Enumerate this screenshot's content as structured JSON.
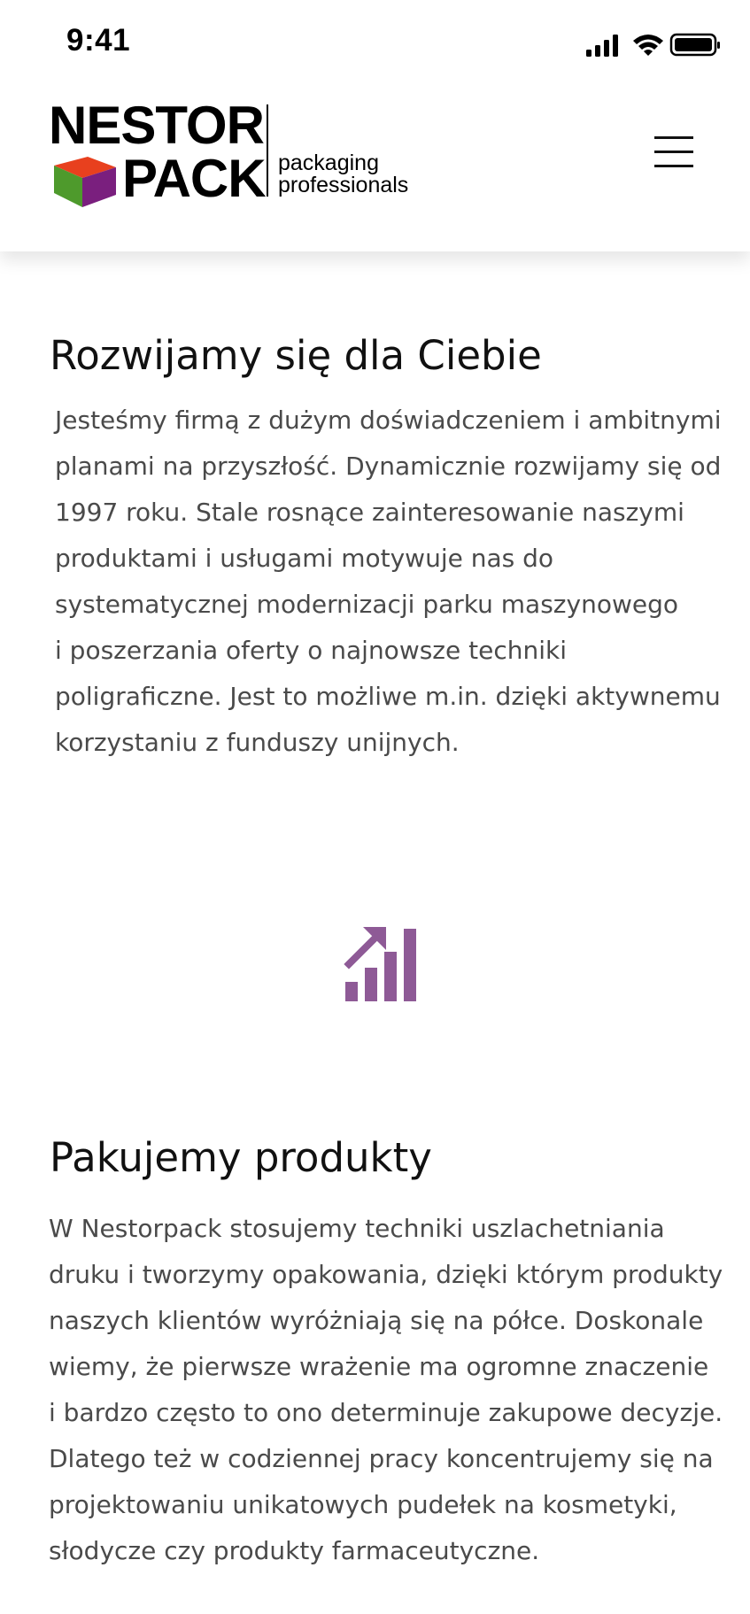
{
  "status_bar": {
    "time": "9:41",
    "icons": [
      "signal-icon",
      "wifi-icon",
      "battery-icon"
    ]
  },
  "header": {
    "logo": {
      "word_top": "NESTOR",
      "word_bottom": "PACK",
      "tagline_line1": "packaging",
      "tagline_line2": "professionals"
    },
    "menu_icon": "hamburger-menu-icon"
  },
  "sections": [
    {
      "title": "Rozwijamy się dla Ciebie",
      "lines": [
        "Jesteśmy firmą z dużym doświadczeniem i ambitnymi",
        "planami na przyszłość. Dynamicznie rozwijamy się od",
        "1997 roku. Stale rosnące zainteresowanie naszymi",
        "produktami i usługami motywuje nas do",
        "systematycznej modernizacji parku maszynowego",
        "i poszerzania oferty o najnowsze techniki",
        "poligraficzne. Jest to możliwe m.in. dzięki aktywnemu",
        "korzystaniu z funduszy unijnych."
      ]
    },
    {
      "icon": "growth-chart-icon",
      "title": "Pakujemy produkty",
      "lines": [
        "W Nestorpack stosujemy techniki uszlachetniania",
        "druku i tworzymy opakowania, dzięki którym produkty",
        "naszych klientów wyróżniają się na półce. Doskonale",
        "wiemy, że pierwsze wrażenie ma ogromne znaczenie",
        "i bardzo często to ono determinuje zakupowe decyzje.",
        "Dlatego też w codziennej pracy koncentrujemy się na",
        "projektowaniu unikatowych pudełek na kosmetyki,",
        "słodycze czy produkty farmaceutyczne."
      ]
    }
  ],
  "colors": {
    "accent": "#8e5a96",
    "text_body": "#4a4a4a",
    "heading": "#111111",
    "cube_top": "#e8401e",
    "cube_left": "#4e9a2c",
    "cube_right": "#7a1f7e"
  }
}
